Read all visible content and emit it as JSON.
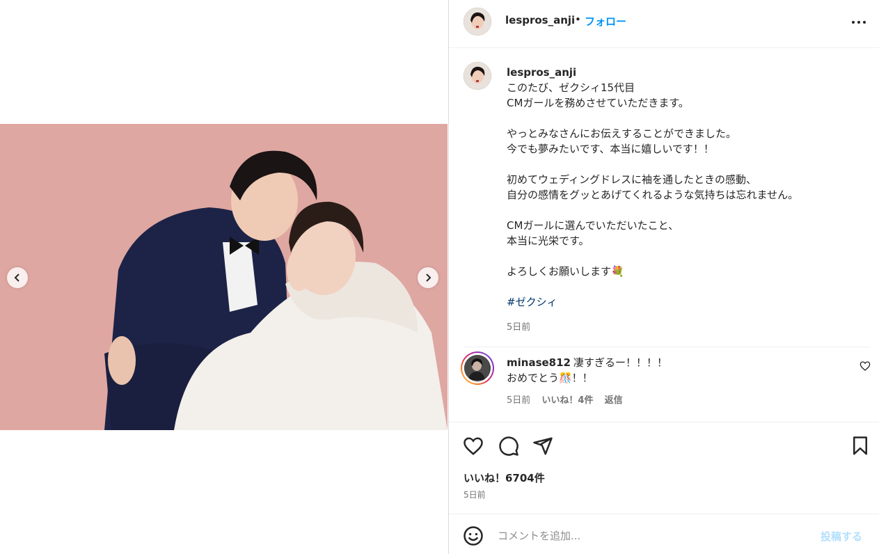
{
  "post": {
    "username": "lespros_anji",
    "dot": "•",
    "follow_label": "フォロー",
    "more_icon": "more-horizontal-icon"
  },
  "caption": {
    "username": "lespros_anji",
    "lines": [
      "このたび、ゼクシィ15代目",
      "CMガールを務めさせていただきます。",
      "",
      "やっとみなさんにお伝えすることができました。",
      "今でも夢みたいです、本当に嬉しいです！！",
      "",
      "初めてウェディングドレスに袖を通したときの感動、",
      "自分の感情をグッとあげてくれるような気持ちは忘れません。",
      "",
      "CMガールに選んでいただいたこと、",
      "本当に光栄です。",
      "",
      "よろしくお願いします💐",
      ""
    ],
    "hashtag": "#ゼクシィ",
    "time": "5日前"
  },
  "comment": {
    "username": "minase812",
    "text_line1": "凄すぎるー！！！！",
    "text_line2": "おめでとう🎊！！",
    "time": "5日前",
    "likes": "いいね！4件",
    "reply": "返信"
  },
  "actions": {
    "like_icon": "heart-icon",
    "comment_icon": "comment-icon",
    "share_icon": "send-icon",
    "save_icon": "bookmark-icon"
  },
  "likes_count": "いいね！6704件",
  "post_time": "5日前",
  "add_comment": {
    "placeholder": "コメントを追加...",
    "post_label": "投稿する"
  },
  "colors": {
    "link_blue": "#0095f6",
    "post_disabled": "#b2dffc",
    "hashtag": "#00376b",
    "photo_background": "#e0a9a3"
  }
}
